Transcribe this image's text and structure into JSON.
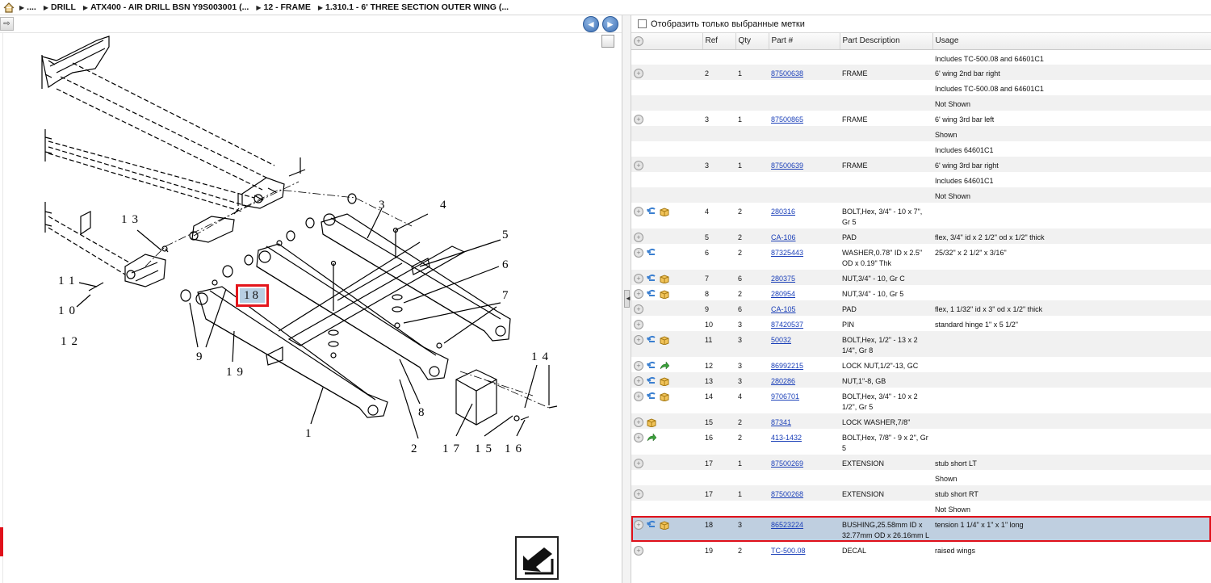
{
  "breadcrumb": {
    "home_icon": "home-icon",
    "items": [
      "....",
      "DRILL",
      "ATX400 - AIR DRILL BSN Y9S003001 (...",
      "12 - FRAME",
      "1.310.1 - 6' THREE SECTION OUTER WING (..."
    ]
  },
  "nav": {
    "back_icon": "arrow-left-icon",
    "forward_icon": "arrow-right-icon"
  },
  "diagram": {
    "labels": [
      "1",
      "2",
      "3",
      "4",
      "5",
      "6",
      "7",
      "8",
      "9",
      "10",
      "11",
      "12",
      "13",
      "14",
      "15",
      "16",
      "17",
      "18",
      "19"
    ],
    "selected_callout": "18"
  },
  "filter": {
    "label": "Отобразить только выбранные метки",
    "checked": false
  },
  "table": {
    "columns": {
      "ref": "Ref",
      "qty": "Qty",
      "part": "Part #",
      "desc": "Part Description",
      "usage": "Usage"
    },
    "rows": [
      {
        "icons": [],
        "ref": "",
        "qty": "",
        "part": "",
        "desc": "",
        "usage": "Includes TC-500.08 and 64601C1"
      },
      {
        "icons": [
          "add"
        ],
        "ref": "2",
        "qty": "1",
        "part": "87500638",
        "desc": "FRAME",
        "usage": "6' wing 2nd bar right"
      },
      {
        "icons": [],
        "ref": "",
        "qty": "",
        "part": "",
        "desc": "",
        "usage": "Includes TC-500.08 and 64601C1"
      },
      {
        "icons": [],
        "ref": "",
        "qty": "",
        "part": "",
        "desc": "",
        "usage": "Not Shown"
      },
      {
        "icons": [
          "add"
        ],
        "ref": "3",
        "qty": "1",
        "part": "87500865",
        "desc": "FRAME",
        "usage": "6' wing 3rd bar left"
      },
      {
        "icons": [],
        "ref": "",
        "qty": "",
        "part": "",
        "desc": "",
        "usage": "Shown"
      },
      {
        "icons": [],
        "ref": "",
        "qty": "",
        "part": "",
        "desc": "",
        "usage": "Includes 64601C1"
      },
      {
        "icons": [
          "add"
        ],
        "ref": "3",
        "qty": "1",
        "part": "87500639",
        "desc": "FRAME",
        "usage": "6' wing 3rd bar right"
      },
      {
        "icons": [],
        "ref": "",
        "qty": "",
        "part": "",
        "desc": "",
        "usage": "Includes 64601C1"
      },
      {
        "icons": [],
        "ref": "",
        "qty": "",
        "part": "",
        "desc": "",
        "usage": "Not Shown"
      },
      {
        "icons": [
          "add",
          "swap",
          "box"
        ],
        "ref": "4",
        "qty": "2",
        "part": "280316",
        "desc": "BOLT,Hex, 3/4\" - 10 x 7\", Gr 5",
        "usage": ""
      },
      {
        "icons": [
          "add"
        ],
        "ref": "5",
        "qty": "2",
        "part": "CA-106",
        "desc": "PAD",
        "usage": "flex, 3/4\" id x 2 1/2\" od x 1/2\" thick"
      },
      {
        "icons": [
          "add",
          "swap"
        ],
        "ref": "6",
        "qty": "2",
        "part": "87325443",
        "desc": "WASHER,0.78\" ID x 2.5\" OD x 0.19\" Thk",
        "usage": "25/32\" x 2 1/2\" x 3/16\""
      },
      {
        "icons": [
          "add",
          "swap",
          "box"
        ],
        "ref": "7",
        "qty": "6",
        "part": "280375",
        "desc": "NUT,3/4\" - 10, Gr C",
        "usage": ""
      },
      {
        "icons": [
          "add",
          "swap",
          "box"
        ],
        "ref": "8",
        "qty": "2",
        "part": "280954",
        "desc": "NUT,3/4\" - 10, Gr 5",
        "usage": ""
      },
      {
        "icons": [
          "add"
        ],
        "ref": "9",
        "qty": "6",
        "part": "CA-105",
        "desc": "PAD",
        "usage": "flex, 1 1/32\" id x 3\" od x 1/2\" thick"
      },
      {
        "icons": [
          "add"
        ],
        "ref": "10",
        "qty": "3",
        "part": "87420537",
        "desc": "PIN",
        "usage": "standard hinge 1\" x 5 1/2\""
      },
      {
        "icons": [
          "add",
          "swap",
          "box"
        ],
        "ref": "11",
        "qty": "3",
        "part": "50032",
        "desc": "BOLT,Hex, 1/2\" - 13 x 2 1/4\", Gr 8",
        "usage": ""
      },
      {
        "icons": [
          "add",
          "swap",
          "replace"
        ],
        "ref": "12",
        "qty": "3",
        "part": "86992215",
        "desc": "LOCK NUT,1/2\"-13, GC",
        "usage": ""
      },
      {
        "icons": [
          "add",
          "swap",
          "box"
        ],
        "ref": "13",
        "qty": "3",
        "part": "280286",
        "desc": "NUT,1\"-8, GB",
        "usage": ""
      },
      {
        "icons": [
          "add",
          "swap",
          "box"
        ],
        "ref": "14",
        "qty": "4",
        "part": "9706701",
        "desc": "BOLT,Hex, 3/4\" - 10 x 2 1/2\", Gr 5",
        "usage": ""
      },
      {
        "icons": [
          "add",
          "box"
        ],
        "ref": "15",
        "qty": "2",
        "part": "87341",
        "desc": "LOCK WASHER,7/8\"",
        "usage": ""
      },
      {
        "icons": [
          "add",
          "replace"
        ],
        "ref": "16",
        "qty": "2",
        "part": "413-1432",
        "desc": "BOLT,Hex, 7/8\" - 9 x 2\", Gr 5",
        "usage": ""
      },
      {
        "icons": [
          "add"
        ],
        "ref": "17",
        "qty": "1",
        "part": "87500269",
        "desc": "EXTENSION",
        "usage": "stub short LT"
      },
      {
        "icons": [],
        "ref": "",
        "qty": "",
        "part": "",
        "desc": "",
        "usage": "Shown"
      },
      {
        "icons": [
          "add"
        ],
        "ref": "17",
        "qty": "1",
        "part": "87500268",
        "desc": "EXTENSION",
        "usage": "stub short RT"
      },
      {
        "icons": [],
        "ref": "",
        "qty": "",
        "part": "",
        "desc": "",
        "usage": "Not Shown"
      },
      {
        "icons": [
          "add",
          "swap",
          "box"
        ],
        "ref": "18",
        "qty": "3",
        "part": "86523224",
        "desc": "BUSHING,25.58mm ID x 32.77mm OD x 26.16mm L",
        "usage": "tension 1 1/4\" x 1\" x 1\" long",
        "selected": true
      },
      {
        "icons": [
          "add"
        ],
        "ref": "19",
        "qty": "2",
        "part": "TC-500.08",
        "desc": "DECAL",
        "usage": "raised wings"
      }
    ]
  },
  "colors": {
    "selected_row": "#bfcfe0",
    "highlight": "#e0101a",
    "link": "#1a3fb8"
  }
}
